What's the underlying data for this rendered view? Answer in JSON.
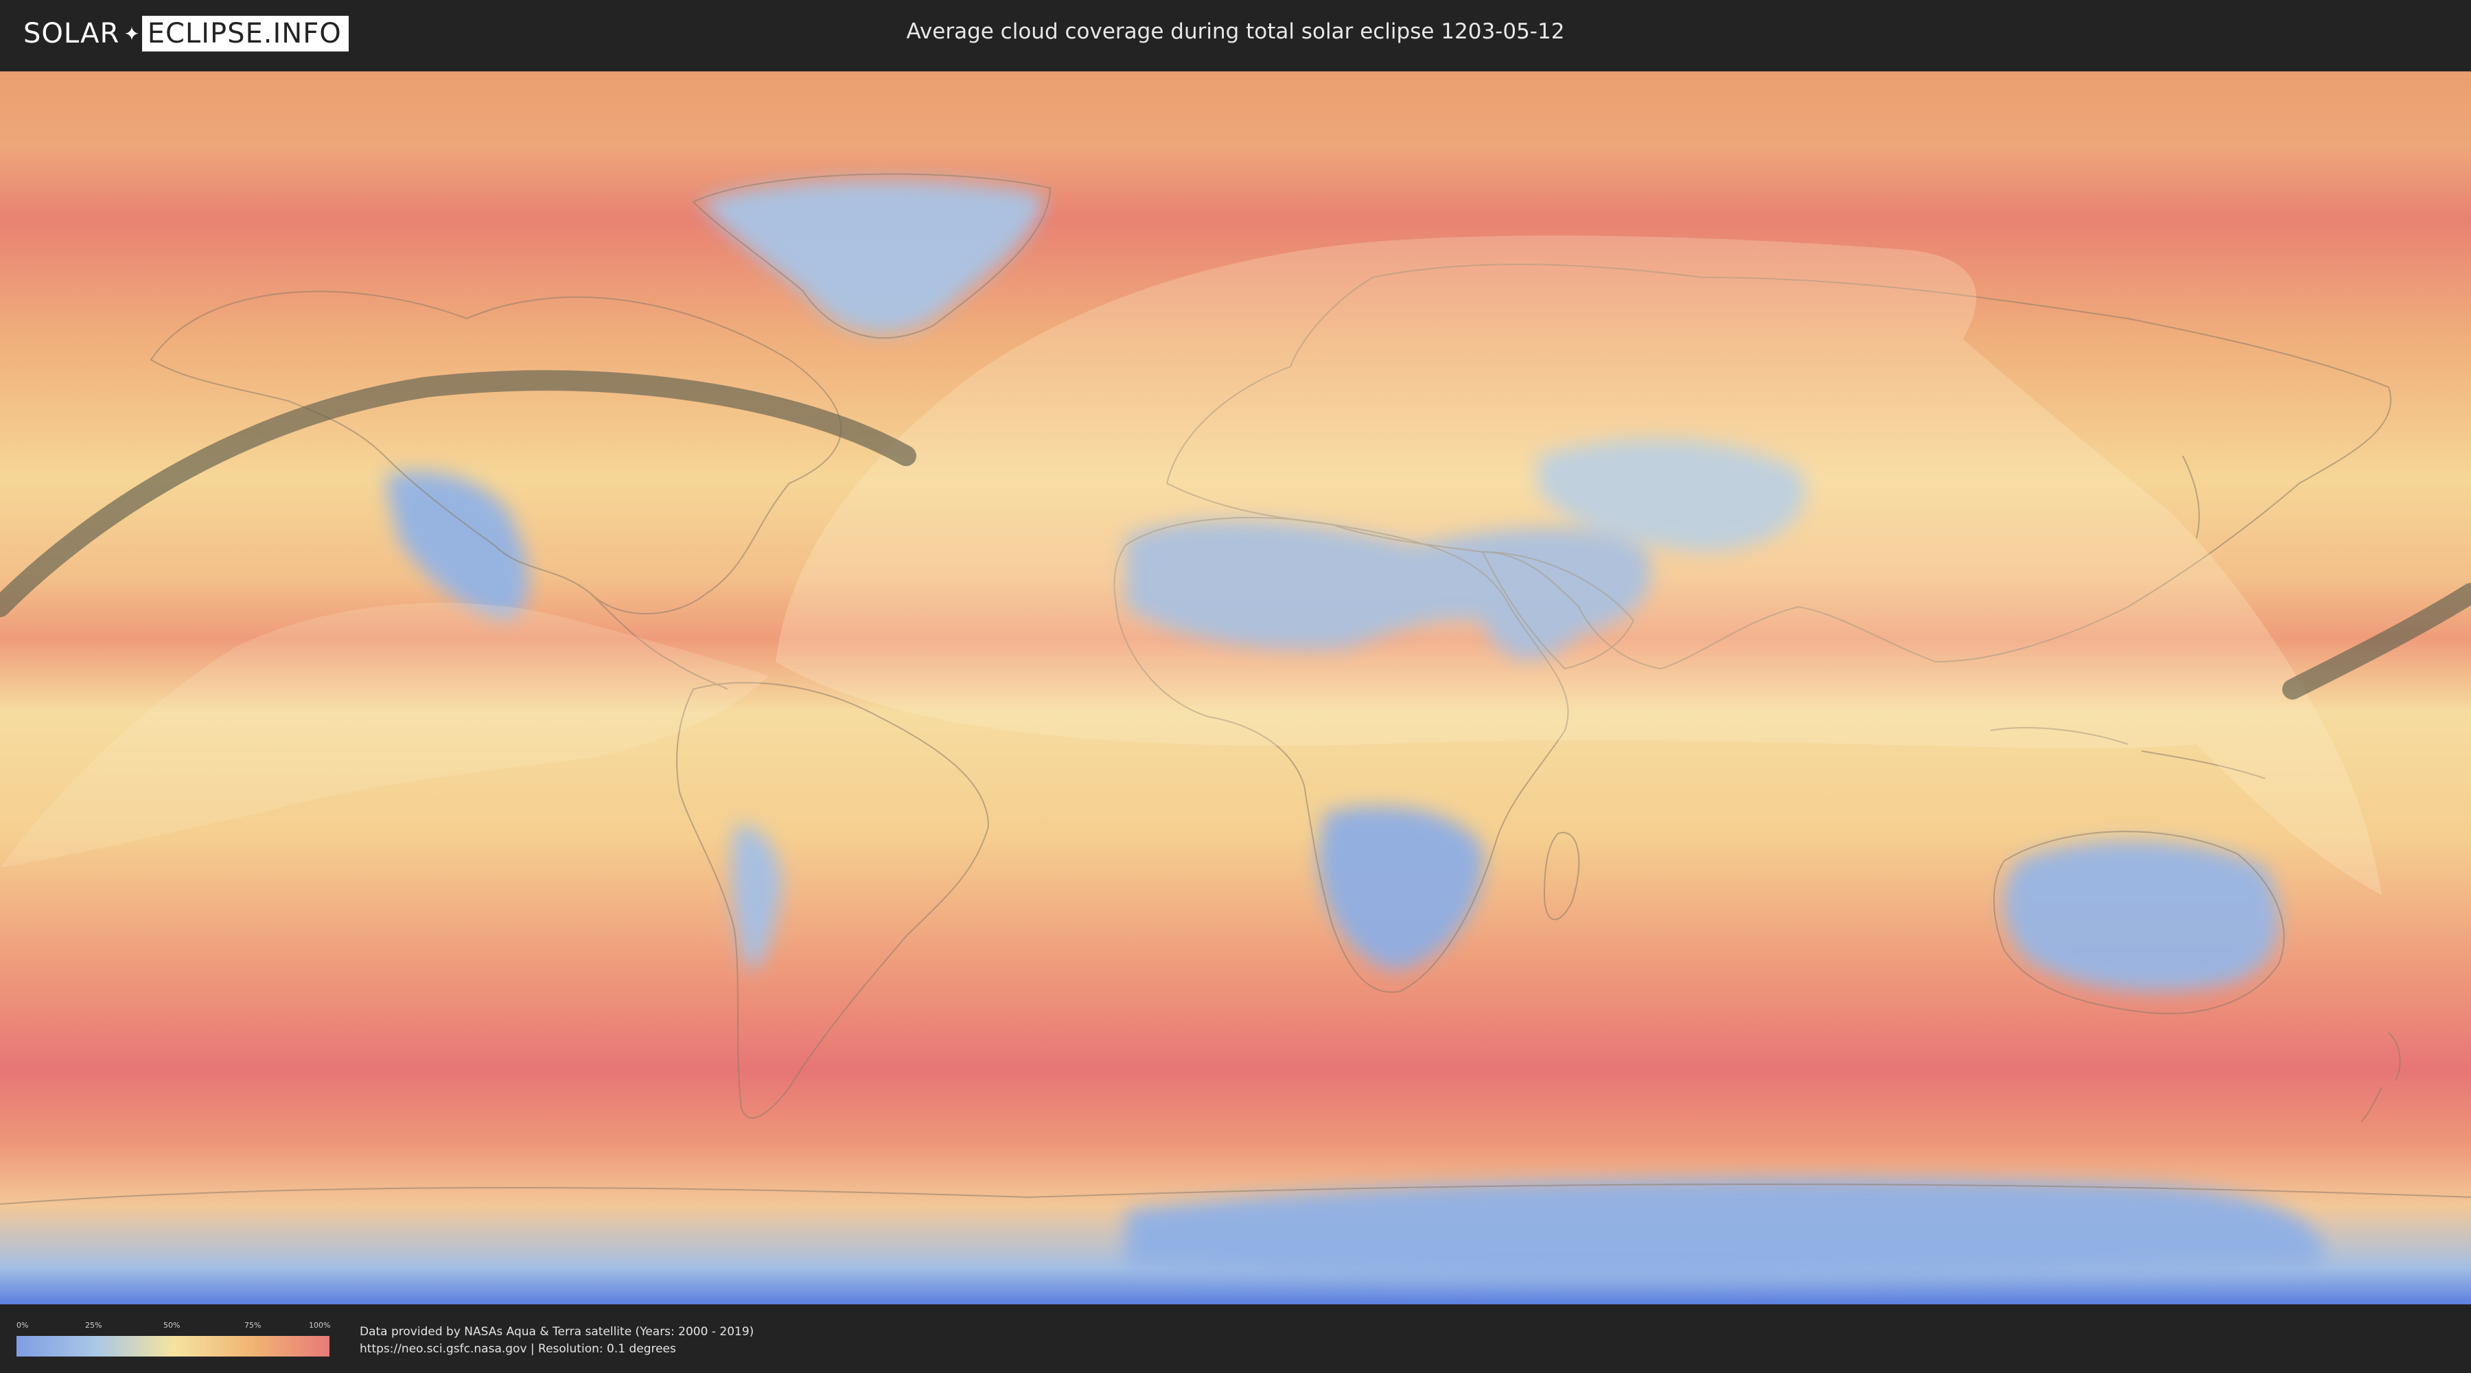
{
  "header": {
    "logo": {
      "part1": "SOLAR",
      "part2": "ECLIPSE.INFO"
    },
    "title": "Average cloud coverage during total solar eclipse 1203-05-12"
  },
  "map": {
    "layer": "Average cloud coverage",
    "eclipse_date": "1203-05-12",
    "colors": {
      "low": "#7f9ee3",
      "mid": "#f4e3a0",
      "high": "#e97a78",
      "eclipse_path": "#6b6653",
      "visibility_overlay": "#fff2c8"
    }
  },
  "legend": {
    "ticks": [
      "0%",
      "25%",
      "50%",
      "75%",
      "100%"
    ]
  },
  "footer": {
    "credit_line1": "Data provided by NASAs Aqua & Terra satellite (Years: 2000 - 2019)",
    "credit_line2": "https://neo.sci.gsfc.nasa.gov | Resolution: 0.1 degrees"
  }
}
